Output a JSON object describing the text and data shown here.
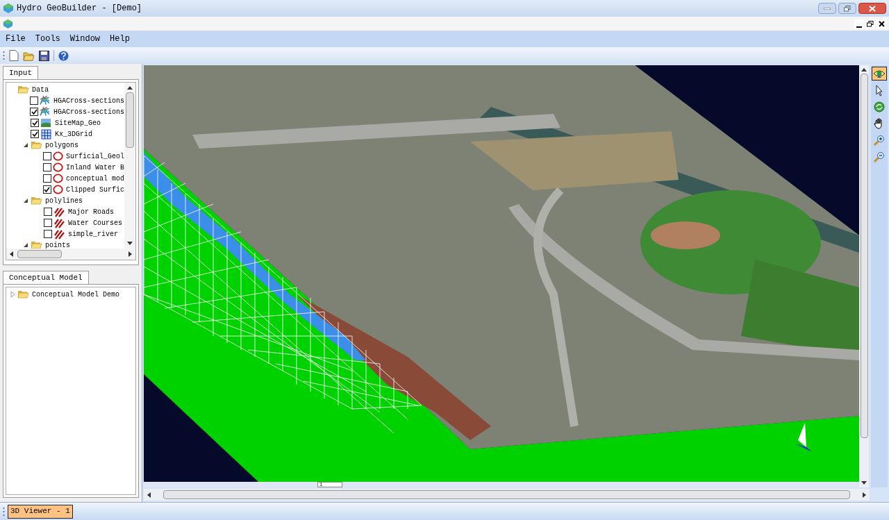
{
  "window": {
    "title": "Hydro GeoBuilder - [Demo]"
  },
  "menu": [
    "File",
    "Tools",
    "Window",
    "Help"
  ],
  "input_panel": {
    "tab": "Input",
    "tree": [
      {
        "label": "Data",
        "kind": "folder",
        "children": [
          {
            "label": "HGACross-sections",
            "kind": "cross-section",
            "checked": false
          },
          {
            "label": "HGACross-sections",
            "kind": "cross-section",
            "checked": true
          },
          {
            "label": "SiteMap_Geo",
            "kind": "image",
            "checked": true
          },
          {
            "label": "Kx_3DGrid",
            "kind": "grid",
            "checked": true
          },
          {
            "label": "polygons",
            "kind": "folder",
            "expanded": true,
            "children": [
              {
                "label": "Surficial_Geol",
                "kind": "polygon",
                "checked": false
              },
              {
                "label": "Inland Water B",
                "kind": "polygon",
                "checked": false
              },
              {
                "label": "conceptual mod",
                "kind": "polygon",
                "checked": false
              },
              {
                "label": "Clipped Surfic",
                "kind": "polygon",
                "checked": true
              }
            ]
          },
          {
            "label": "polylines",
            "kind": "folder",
            "expanded": true,
            "children": [
              {
                "label": "Major Roads",
                "kind": "polyline",
                "checked": false
              },
              {
                "label": "Water Courses",
                "kind": "polyline",
                "checked": false
              },
              {
                "label": "simple_river",
                "kind": "polyline",
                "checked": false
              }
            ]
          },
          {
            "label": "points",
            "kind": "folder",
            "expanded": true
          }
        ]
      }
    ]
  },
  "model_panel": {
    "tab": "Conceptual Model",
    "tree": [
      {
        "label": "Conceptual Model Demo",
        "kind": "folder",
        "expanded": false
      }
    ]
  },
  "viewer": {
    "frame_field": "1"
  },
  "view_tools": [
    {
      "kind": "eye",
      "selected": true
    },
    {
      "kind": "pointer",
      "selected": false
    },
    {
      "kind": "rotate",
      "selected": false
    },
    {
      "kind": "pan",
      "selected": false
    },
    {
      "kind": "zoom-in",
      "selected": false
    },
    {
      "kind": "zoom-out",
      "selected": false
    }
  ],
  "taskbar": [
    {
      "label": "3D Viewer - 1",
      "selected": true
    }
  ]
}
